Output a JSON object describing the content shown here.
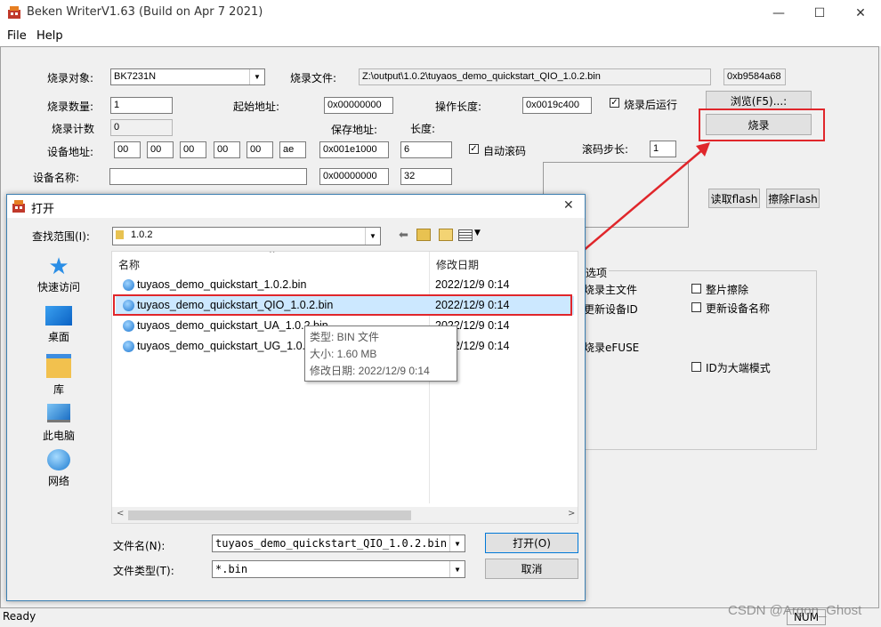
{
  "window": {
    "title": "Beken WriterV1.63 (Build on Apr  7 2021)",
    "minimize_glyph": "—",
    "maximize_glyph": "☐",
    "close_glyph": "✕"
  },
  "menu": {
    "file": "File",
    "help": "Help"
  },
  "form": {
    "target_label": "烧录对象:",
    "target_value": "BK7231N",
    "file_label": "烧录文件:",
    "file_value": "Z:\\output\\1.0.2\\tuyaos_demo_quickstart_QIO_1.0.2.bin",
    "checksum_value": "0xb9584a68",
    "count_label": "烧录数量:",
    "count_value": "1",
    "start_addr_label": "起始地址:",
    "start_addr_value": "0x00000000",
    "op_len_label": "操作长度:",
    "op_len_value": "0x0019c400",
    "run_after_label": "烧录后运行",
    "browse_label": "浏览(F5)...:",
    "burn_label": "烧录",
    "burn_count_label": "烧录计数",
    "burn_count_value": "0",
    "save_addr_label": "保存地址:",
    "length_label": "长度:",
    "device_addr_label": "设备地址:",
    "mac": [
      "00",
      "00",
      "00",
      "00",
      "00",
      "ae"
    ],
    "dev_addr_value": "0x001e1000",
    "dev_len_value": "6",
    "auto_roll_label": "自动滚码",
    "roll_step_label": "滚码步长:",
    "roll_step_value": "1",
    "device_name_label": "设备名称:",
    "name_addr_value": "0x00000000",
    "name_len_value": "32",
    "read_flash_label": "读取flash",
    "erase_flash_label": "擦除Flash",
    "options_title": "选项",
    "opt_main_file": "烧录主文件",
    "opt_update_id": "更新设备ID",
    "opt_efuse": "烧录eFUSE",
    "opt_chip_erase": "整片擦除",
    "opt_update_name": "更新设备名称",
    "opt_big_endian": "ID为大端模式"
  },
  "status": {
    "ready": "Ready",
    "num": "NUM",
    "watermark": "CSDN @Argon_Ghost"
  },
  "dialog": {
    "title": "打开",
    "lookin_label": "查找范围(I):",
    "lookin_value": "1.0.2",
    "places": [
      "快速访问",
      "桌面",
      "库",
      "此电脑",
      "网络"
    ],
    "col_name": "名称",
    "col_date": "修改日期",
    "files": [
      {
        "name": "tuyaos_demo_quickstart_1.0.2.bin",
        "date": "2022/12/9 0:14"
      },
      {
        "name": "tuyaos_demo_quickstart_QIO_1.0.2.bin",
        "date": "2022/12/9 0:14"
      },
      {
        "name": "tuyaos_demo_quickstart_UA_1.0.2.bin",
        "date": "2022/12/9 0:14"
      },
      {
        "name": "tuyaos_demo_quickstart_UG_1.0.2.bin",
        "date": "2022/12/9 0:14"
      }
    ],
    "tooltip": {
      "type": "类型: BIN 文件",
      "size": "大小: 1.60 MB",
      "modified": "修改日期: 2022/12/9 0:14"
    },
    "filename_label": "文件名(N):",
    "filename_value": "tuyaos_demo_quickstart_QIO_1.0.2.bin",
    "filetype_label": "文件类型(T):",
    "filetype_value": "*.bin",
    "open_label": "打开(O)",
    "cancel_label": "取消"
  },
  "colors": {
    "highlight": "#e0262b",
    "selection": "#cce8ff",
    "dialog_border": "#3c7fb1"
  }
}
